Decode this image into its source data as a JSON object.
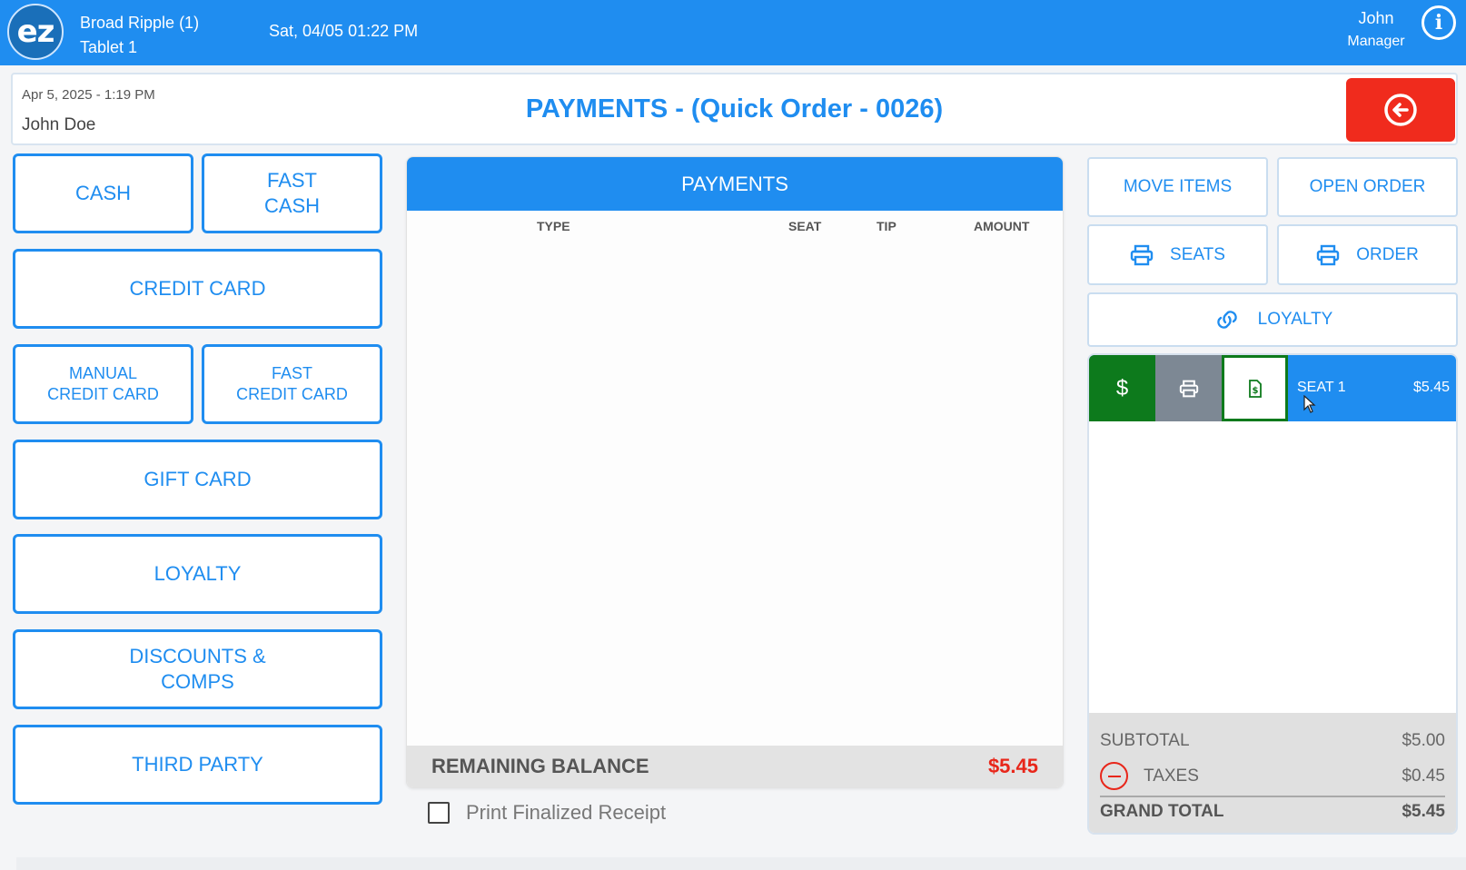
{
  "topbar": {
    "logo_text": "ez",
    "location": "Broad Ripple (1)",
    "device": "Tablet 1",
    "datetime": "Sat, 04/05 01:22 PM",
    "user_name": "John",
    "user_role": "Manager",
    "info_icon": "info-icon",
    "background_color": "#1f8df0"
  },
  "header": {
    "date": "Apr 5, 2025  - 1:19 PM",
    "customer": "John Doe",
    "title": "PAYMENTS - (Quick Order - 0026)",
    "back_icon": "arrow-left-circle-icon",
    "back_color": "#f02b1d"
  },
  "payment_methods": {
    "cash": "CASH",
    "fast_cash_1": "FAST",
    "fast_cash_2": "CASH",
    "credit_card": "CREDIT CARD",
    "manual_cc_1": "MANUAL",
    "manual_cc_2": "CREDIT CARD",
    "fast_cc_1": "FAST",
    "fast_cc_2": "CREDIT CARD",
    "gift_card": "GIFT CARD",
    "loyalty": "LOYALTY",
    "discounts_1": "DISCOUNTS &",
    "discounts_2": "COMPS",
    "third_party": "THIRD PARTY"
  },
  "payments": {
    "header": "PAYMENTS",
    "columns": [
      "TYPE",
      "SEAT",
      "TIP",
      "AMOUNT"
    ],
    "rows": [],
    "remaining_label": "REMAINING BALANCE",
    "remaining_value": "$5.45",
    "print_receipt_label": "Print Finalized Receipt",
    "print_receipt_checked": false
  },
  "actions": {
    "move_items": "MOVE ITEMS",
    "open_order": "OPEN ORDER",
    "seats": "SEATS",
    "order": "ORDER",
    "loyalty": "LOYALTY",
    "print_icon": "printer-icon",
    "link_icon": "link-icon"
  },
  "seats": [
    {
      "name": "SEAT 1",
      "amount": "$5.45",
      "pay_symbol": "$"
    }
  ],
  "totals": {
    "subtotal_label": "SUBTOTAL",
    "subtotal_value": "$5.00",
    "taxes_label": "TAXES",
    "taxes_value": "$0.45",
    "grand_label": "GRAND TOTAL",
    "grand_value": "$5.45"
  },
  "colors": {
    "accent": "#1f8df0",
    "alert": "#e8261a",
    "pay_green": "#0d7a1c",
    "print_gray": "#7d8894"
  }
}
